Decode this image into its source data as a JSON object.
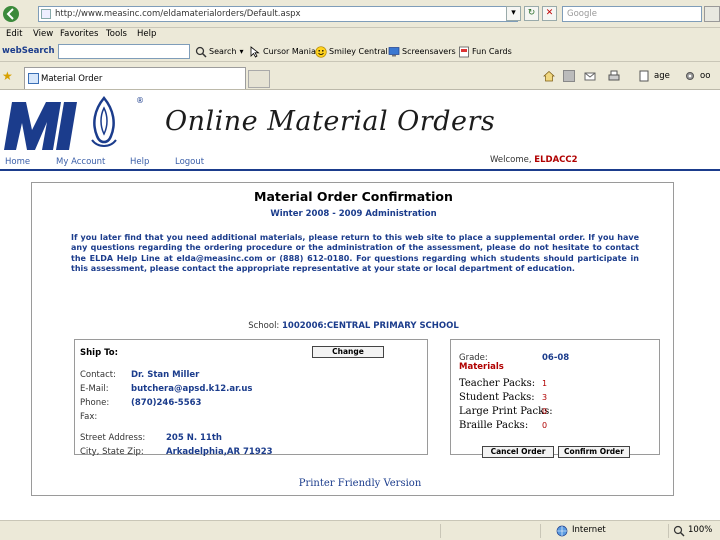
{
  "browser": {
    "url": "http://www.measinc.com/eldamaterialorders/Default.aspx",
    "search_placeholder": "Google",
    "menu": [
      "Edit",
      "View",
      "Favorites",
      "Tools",
      "Help"
    ],
    "toolbar": {
      "brand": "webSearch",
      "search_button": "Search",
      "items": [
        "Cursor Mania",
        "Smiley Central",
        "Screensavers",
        "Fun Cards"
      ]
    },
    "tab_title": "Material Order",
    "commands": {
      "page": "age",
      "tools": "oo"
    },
    "status": {
      "zone": "Internet",
      "zoom": "100%"
    }
  },
  "page": {
    "title": "Online Material Orders",
    "nav": [
      "Home",
      "My Account",
      "Help",
      "Logout"
    ],
    "welcome_text": "Welcome,",
    "welcome_user": "ELDACC2",
    "confirmation_title": "Material Order Confirmation",
    "administration": "Winter 2008 - 2009 Administration",
    "notice": "If you later find that you need additional materials, please return to this web site to place a supplemental order. If you have any questions regarding the ordering procedure or the administration of the assessment, please do not hesitate to contact the ELDA Help Line at elda@measinc.com or (888) 612-0180. For questions regarding which students should participate in this assessment, please contact the appropriate representative at your state or local department of education.",
    "school_label": "School:",
    "school_value": "1002006:CENTRAL PRIMARY SCHOOL",
    "ship_to": {
      "heading": "Ship To:",
      "change_button": "Change",
      "fields": [
        {
          "label": "Contact:",
          "value": "Dr. Stan Miller"
        },
        {
          "label": "E-Mail:",
          "value": "butchera@apsd.k12.ar.us"
        },
        {
          "label": "Phone:",
          "value": "(870)246-5563"
        },
        {
          "label": "Fax:",
          "value": ""
        },
        {
          "label": "Street Address:",
          "value": "205 N. 11th"
        },
        {
          "label": "City, State Zip:",
          "value": "Arkadelphia,AR 71923"
        }
      ]
    },
    "materials": {
      "grade_label": "Grade:",
      "grade_value": "06-08",
      "heading": "Materials",
      "packs": [
        {
          "label": "Teacher Packs:",
          "value": "1"
        },
        {
          "label": "Student Packs:",
          "value": "3"
        },
        {
          "label": "Large Print Packs:",
          "value": "0"
        },
        {
          "label": "Braille Packs:",
          "value": "0"
        }
      ],
      "cancel_button": "Cancel Order",
      "confirm_button": "Confirm Order"
    },
    "printer_link": "Printer Friendly Version"
  }
}
